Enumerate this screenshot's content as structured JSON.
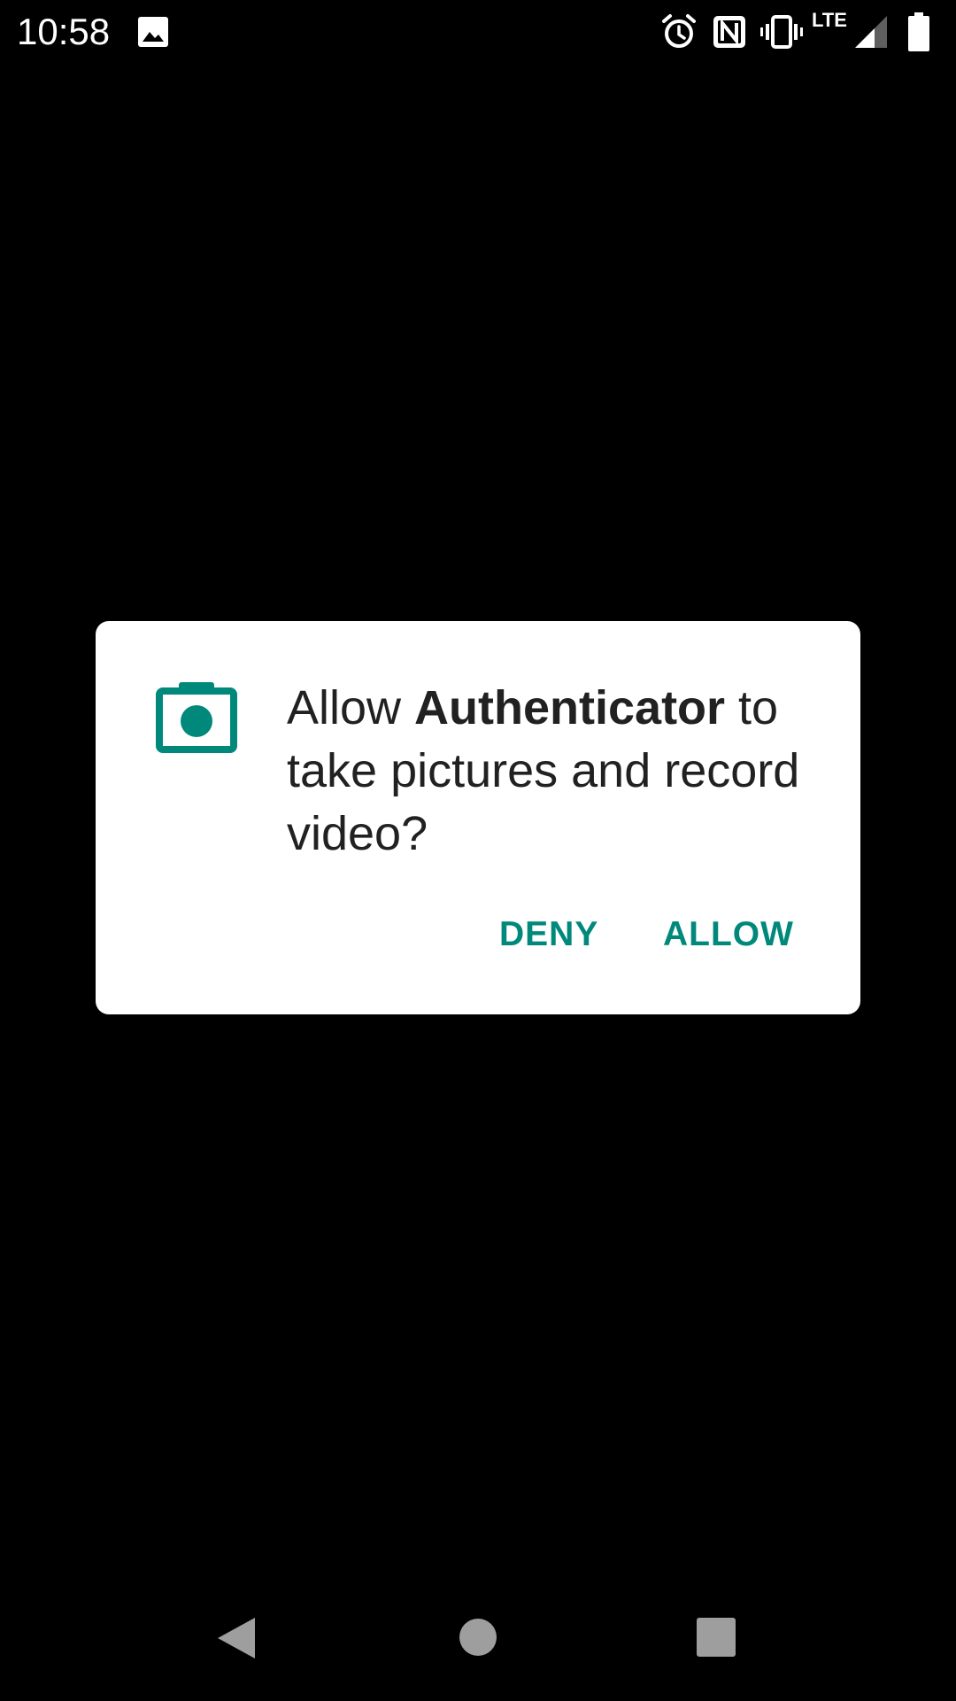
{
  "status_bar": {
    "time": "10:58",
    "network_label": "LTE",
    "icons": [
      "image-icon",
      "alarm-icon",
      "nfc-icon",
      "vibrate-icon",
      "signal-icon",
      "battery-icon"
    ]
  },
  "dialog": {
    "icon": "camera-icon",
    "message_prefix": "Allow ",
    "app_name": "Authenticator",
    "message_suffix": " to take pictures and record video?",
    "deny_label": "DENY",
    "allow_label": "ALLOW"
  },
  "nav_bar": {
    "icons": [
      "back-icon",
      "home-icon",
      "recents-icon"
    ]
  },
  "colors": {
    "background": "#000000",
    "dialog_background": "#ffffff",
    "accent": "#00897b",
    "message_text": "#212121",
    "nav_icons": "#9e9e9e"
  }
}
